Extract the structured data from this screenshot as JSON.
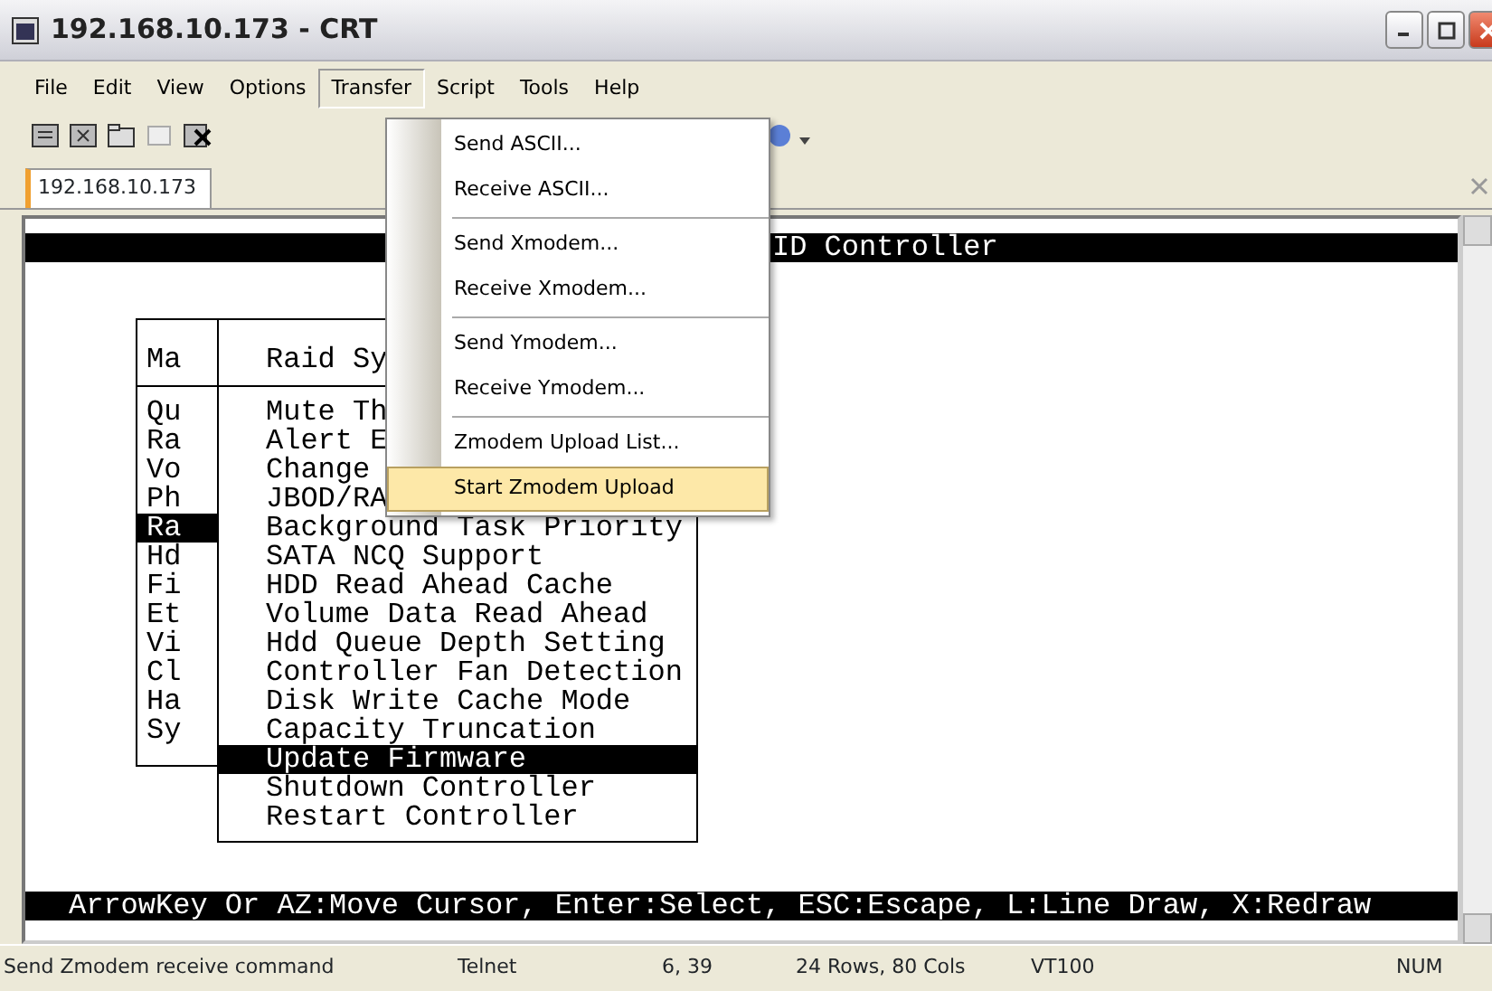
{
  "window": {
    "title": "192.168.10.173 - CRT"
  },
  "menu_bar": [
    {
      "label": "File",
      "selected": false
    },
    {
      "label": "Edit",
      "selected": false
    },
    {
      "label": "View",
      "selected": false
    },
    {
      "label": "Options",
      "selected": false
    },
    {
      "label": "Transfer",
      "selected": true
    },
    {
      "label": "Script",
      "selected": false
    },
    {
      "label": "Tools",
      "selected": false
    },
    {
      "label": "Help",
      "selected": false
    }
  ],
  "tab": {
    "label": "192.168.10.173"
  },
  "terminal": {
    "header_line": "ID Controller",
    "main_menu": {
      "title": "Ma",
      "items": [
        {
          "label": "Qu",
          "selected": false
        },
        {
          "label": "Ra",
          "selected": false
        },
        {
          "label": "Vo",
          "selected": false
        },
        {
          "label": "Ph",
          "selected": false
        },
        {
          "label": "Ra",
          "selected": true
        },
        {
          "label": "Hd",
          "selected": false
        },
        {
          "label": "Fi",
          "selected": false
        },
        {
          "label": "Et",
          "selected": false
        },
        {
          "label": "Vi",
          "selected": false
        },
        {
          "label": "Cl",
          "selected": false
        },
        {
          "label": "Ha",
          "selected": false
        },
        {
          "label": "Sy",
          "selected": false
        }
      ]
    },
    "submenu": {
      "title": "Raid Sy",
      "items": [
        {
          "label": "Mute Th",
          "selected": false
        },
        {
          "label": "Alert E",
          "selected": false
        },
        {
          "label": "Change",
          "selected": false
        },
        {
          "label": "JBOD/RA",
          "selected": false
        },
        {
          "label": "Background Task Priority",
          "selected": false
        },
        {
          "label": "SATA NCQ Support",
          "selected": false
        },
        {
          "label": "HDD Read Ahead Cache",
          "selected": false
        },
        {
          "label": "Volume Data Read Ahead",
          "selected": false
        },
        {
          "label": "Hdd Queue Depth Setting",
          "selected": false
        },
        {
          "label": "Controller Fan Detection",
          "selected": false
        },
        {
          "label": "Disk Write Cache Mode",
          "selected": false
        },
        {
          "label": "Capacity Truncation",
          "selected": false
        },
        {
          "label": "Update Firmware",
          "selected": true
        },
        {
          "label": "Shutdown Controller",
          "selected": false
        },
        {
          "label": "Restart Controller",
          "selected": false
        }
      ]
    },
    "help_line": "ArrowKey Or AZ:Move Cursor, Enter:Select, ESC:Escape, L:Line Draw, X:Redraw"
  },
  "transfer_menu": [
    {
      "kind": "item",
      "label": "Send ASCII...",
      "selected": false
    },
    {
      "kind": "item",
      "label": "Receive ASCII...",
      "selected": false
    },
    {
      "kind": "separator"
    },
    {
      "kind": "item",
      "label": "Send Xmodem...",
      "selected": false
    },
    {
      "kind": "item",
      "label": "Receive Xmodem...",
      "selected": false
    },
    {
      "kind": "separator"
    },
    {
      "kind": "item",
      "label": "Send Ymodem...",
      "selected": false
    },
    {
      "kind": "item",
      "label": "Receive Ymodem...",
      "selected": false
    },
    {
      "kind": "separator"
    },
    {
      "kind": "item",
      "label": "Zmodem Upload List...",
      "selected": false
    },
    {
      "kind": "item",
      "label": "Start Zmodem Upload",
      "selected": true
    }
  ],
  "status_bar": {
    "message": "Send Zmodem receive command",
    "protocol": "Telnet",
    "cursor": "6, 39",
    "size": "24 Rows, 80 Cols",
    "emulation": "VT100",
    "num_lock": "NUM"
  }
}
